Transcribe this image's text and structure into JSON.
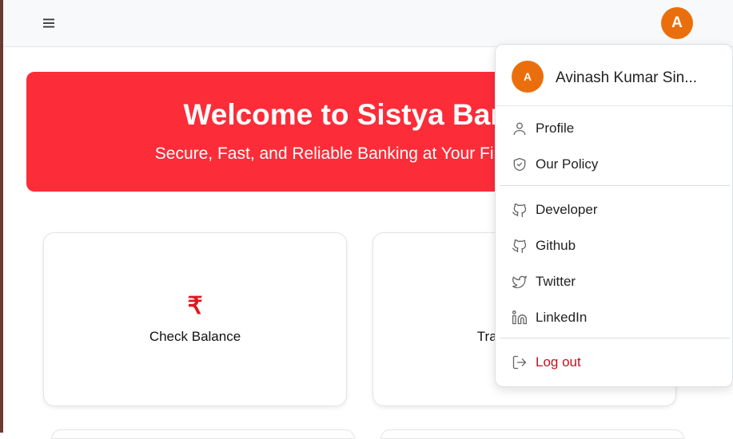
{
  "topbar": {
    "user_initial": "A"
  },
  "hero": {
    "title": "Welcome to Sistya Bank",
    "subtitle": "Secure, Fast, and Reliable Banking at Your Fingertips"
  },
  "cards": [
    {
      "icon": "rupee-icon",
      "symbol": "₹",
      "label": "Check Balance"
    },
    {
      "icon": "transfer-icon",
      "label": "Transfer Money"
    }
  ],
  "dropdown": {
    "avatar_initial": "A",
    "user_name": "Avinash Kumar Sin...",
    "items": [
      {
        "icon": "user-icon",
        "label": "Profile"
      },
      {
        "icon": "shield-icon",
        "label": "Our Policy"
      },
      {
        "icon": "github-icon",
        "label": "Developer"
      },
      {
        "icon": "github-icon",
        "label": "Github"
      },
      {
        "icon": "twitter-icon",
        "label": "Twitter"
      },
      {
        "icon": "linkedin-icon",
        "label": "LinkedIn"
      },
      {
        "icon": "logout-icon",
        "label": "Log out"
      }
    ]
  },
  "colors": {
    "brand_red": "#fd2c39",
    "avatar_orange": "#ea6f0c",
    "logout_red": "#c4121c",
    "rupee_red": "#e0171f"
  }
}
